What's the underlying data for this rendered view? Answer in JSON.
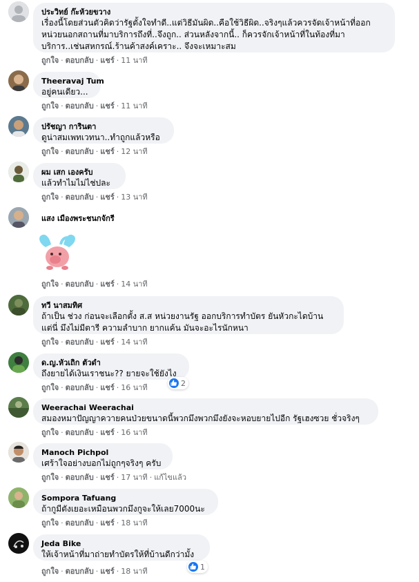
{
  "comments": [
    {
      "author": "ประวิทย์ ก๊ะห้วยขวาง",
      "lines": [
        "เรื่องนี้โดยส่วนตัวคิดว่ารัฐตั้งใจทำดี..แต่วิธีมันผิด..คือใช้วิธีผิด..จริงๆแล้วควรจัดเจ้าหน้าที่ออก",
        "หน่วยนอกสถานที่มาบริการถึงที่..จึงถูก.. ส่วนหลังจากนี้.. ก็ควรจักเจ้าหน้าที่ในท้องที่มา",
        "บริการ..เช่นสหกรณ์.ร้านค้าสงค์เคราะ.. จึงจะเหมาะสม"
      ],
      "like": "ถูกใจ",
      "reply": "ตอบกลับ",
      "share": "แชร์",
      "time": "11 นาที"
    },
    {
      "author": "Theeravaj Tum",
      "lines": [
        "อยู่คนเดียว..."
      ],
      "like": "ถูกใจ",
      "reply": "ตอบกลับ",
      "share": "แชร์",
      "time": "11 นาที"
    },
    {
      "author": "ปรัชญา การินตา",
      "lines": [
        "ดูน่าสมเพทเวทนา..ทำถูกแล้วหรือ"
      ],
      "like": "ถูกใจ",
      "reply": "ตอบกลับ",
      "share": "แชร์",
      "time": "12 นาที"
    },
    {
      "author": "ผม เสก เองครับ",
      "lines": [
        "แล้วทำไมไม่ไช่ปละ"
      ],
      "like": "ถูกใจ",
      "reply": "ตอบกลับ",
      "share": "แชร์",
      "time": "13 นาที"
    },
    {
      "author": "แสง เมืองพระชนกจักรี",
      "lines": [],
      "like": "ถูกใจ",
      "reply": "ตอบกลับ",
      "share": "แชร์",
      "time": "14 นาที"
    },
    {
      "author": "ทวี นาสมทิศ",
      "lines": [
        "ถ้าเป็น ช่วง ก่อนจะเลือกตั้ง ส.ส หน่วยงานรัฐ ออกบริการทำบัตร ยันหัวกะไดบ้าน",
        "แต่นี่ มึงไม่มีตารี ความลำบาก ยากแค้น มันจะอะไรนักหนา"
      ],
      "like": "ถูกใจ",
      "reply": "ตอบกลับ",
      "share": "แชร์",
      "time": "14 นาที"
    },
    {
      "author": "ด.ญ.หัวเถิก ตัวดำ",
      "lines": [
        "ถึงยายได้เงินเราชนะ?? ยายจะใช้ยังไง"
      ],
      "like": "ถูกใจ",
      "reply": "ตอบกลับ",
      "share": "แชร์",
      "time": "16 นาที",
      "reactions": "2"
    },
    {
      "author": "Weerachai Weerachai",
      "lines": [
        "สมองหมาปัญญาควายคนป่วยขนาดนี้พวกมึงพวกมึงยังจะหอบยายไปอีก รัฐเฮงซวย ชั่วจริงๆ"
      ],
      "like": "ถูกใจ",
      "reply": "ตอบกลับ",
      "share": "แชร์",
      "time": "16 นาที"
    },
    {
      "author": "Manoch Pichpol",
      "lines": [
        "เศร้าใจอย่างบอกไม่ถูกๆจริงๆ ครับ"
      ],
      "like": "ถูกใจ",
      "reply": "ตอบกลับ",
      "share": "แชร์",
      "time": "17 นาที",
      "edited": "แก้ไขแล้ว"
    },
    {
      "author": "Sompora Tafuang",
      "lines": [
        "ถ้ากูมีตังเยอะเหมือนพวกมึงกูจะให้เลย7000นะ"
      ],
      "like": "ถูกใจ",
      "reply": "ตอบกลับ",
      "share": "แชร์",
      "time": "18 นาที"
    },
    {
      "author": "Jeda Bike",
      "lines": [
        "ให้เจ้าหน้าที่มาถ่ายทำบัตรให้ที่บ้านดีกว่ามั้ง"
      ],
      "like": "ถูกใจ",
      "reply": "ตอบกลับ",
      "share": "แชร์",
      "time": "18 นาที",
      "reactions": "1"
    }
  ],
  "colors": {
    "bubble": "#f0f2f5",
    "meta": "#65676b",
    "like_blue": "#1877f2"
  },
  "icons": {
    "like": "like-icon",
    "sticker": "pink-creature-sticker"
  }
}
